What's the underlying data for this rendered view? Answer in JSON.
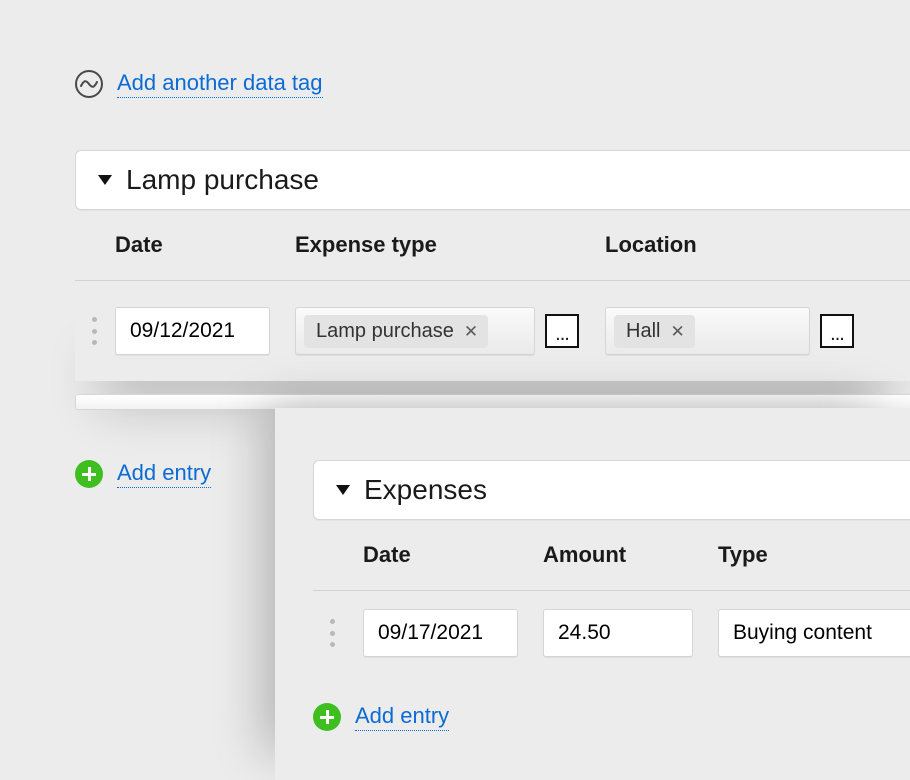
{
  "topLink": {
    "label": "Add another data tag"
  },
  "panel1": {
    "title": "Lamp purchase",
    "columns": {
      "date": "Date",
      "expenseType": "Expense type",
      "location": "Location"
    },
    "row": {
      "date": "09/12/2021",
      "expenseTypeTag": "Lamp purchase",
      "locationTag": "Hall"
    },
    "addEntry": "Add entry"
  },
  "panel2": {
    "title": "Expenses",
    "columns": {
      "date": "Date",
      "amount": "Amount",
      "type": "Type"
    },
    "row": {
      "date": "09/17/2021",
      "amount": "24.50",
      "type": "Buying content"
    },
    "addEntry": "Add entry"
  }
}
